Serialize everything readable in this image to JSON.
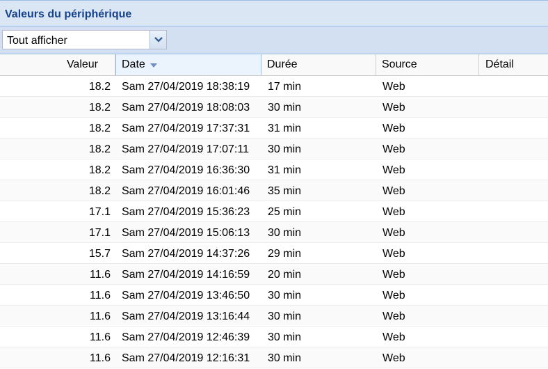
{
  "panel": {
    "title": "Valeurs du périphérique"
  },
  "filter": {
    "selected": "Tout afficher",
    "trigger_icon": "chevron-down-icon"
  },
  "columns": {
    "value": "Valeur",
    "date": "Date",
    "duration": "Durée",
    "source": "Source",
    "detail": "Détail",
    "sorted_by": "Date",
    "sort_direction": "descending"
  },
  "rows": [
    {
      "value": "18.2",
      "date": "Sam 27/04/2019 18:38:19",
      "duration": "17 min",
      "source": "Web",
      "detail": ""
    },
    {
      "value": "18.2",
      "date": "Sam 27/04/2019 18:08:03",
      "duration": "30 min",
      "source": "Web",
      "detail": ""
    },
    {
      "value": "18.2",
      "date": "Sam 27/04/2019 17:37:31",
      "duration": "31 min",
      "source": "Web",
      "detail": ""
    },
    {
      "value": "18.2",
      "date": "Sam 27/04/2019 17:07:11",
      "duration": "30 min",
      "source": "Web",
      "detail": ""
    },
    {
      "value": "18.2",
      "date": "Sam 27/04/2019 16:36:30",
      "duration": "31 min",
      "source": "Web",
      "detail": ""
    },
    {
      "value": "18.2",
      "date": "Sam 27/04/2019 16:01:46",
      "duration": "35 min",
      "source": "Web",
      "detail": ""
    },
    {
      "value": "17.1",
      "date": "Sam 27/04/2019 15:36:23",
      "duration": "25 min",
      "source": "Web",
      "detail": ""
    },
    {
      "value": "17.1",
      "date": "Sam 27/04/2019 15:06:13",
      "duration": "30 min",
      "source": "Web",
      "detail": ""
    },
    {
      "value": "15.7",
      "date": "Sam 27/04/2019 14:37:26",
      "duration": "29 min",
      "source": "Web",
      "detail": ""
    },
    {
      "value": "11.6",
      "date": "Sam 27/04/2019 14:16:59",
      "duration": "20 min",
      "source": "Web",
      "detail": ""
    },
    {
      "value": "11.6",
      "date": "Sam 27/04/2019 13:46:50",
      "duration": "30 min",
      "source": "Web",
      "detail": ""
    },
    {
      "value": "11.6",
      "date": "Sam 27/04/2019 13:16:44",
      "duration": "30 min",
      "source": "Web",
      "detail": ""
    },
    {
      "value": "11.6",
      "date": "Sam 27/04/2019 12:46:39",
      "duration": "30 min",
      "source": "Web",
      "detail": ""
    },
    {
      "value": "11.6",
      "date": "Sam 27/04/2019 12:16:31",
      "duration": "30 min",
      "source": "Web",
      "detail": ""
    }
  ]
}
